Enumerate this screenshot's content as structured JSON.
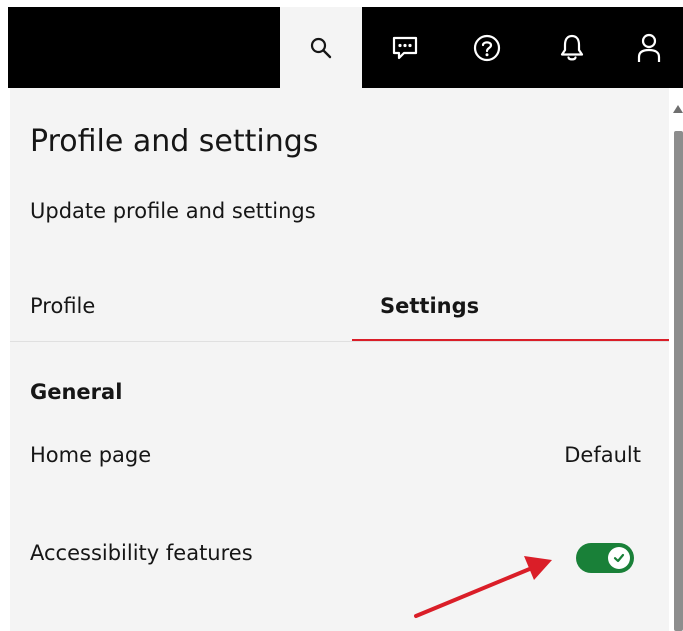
{
  "header": {
    "icons": {
      "search": "search-icon",
      "chat": "chat-icon",
      "help": "help-icon",
      "notifications": "notification-bell-icon",
      "user": "user-icon"
    },
    "colors": {
      "bar_background": "#000000",
      "active_button_background": "#f4f4f4"
    }
  },
  "panel": {
    "title": "Profile and settings",
    "subtitle": "Update profile and settings",
    "tabs": [
      {
        "label": "Profile",
        "selected": false
      },
      {
        "label": "Settings",
        "selected": true
      }
    ],
    "general": {
      "heading": "General",
      "home_page": {
        "label": "Home page",
        "value": "Default"
      },
      "accessibility": {
        "label": "Accessibility features",
        "enabled": true
      }
    },
    "colors": {
      "background": "#f4f4f4",
      "tab_active_underline": "#da1e28",
      "toggle_on": "#198038"
    }
  },
  "annotation": {
    "arrow_color": "#da1e28",
    "points_to": "accessibility-toggle"
  }
}
